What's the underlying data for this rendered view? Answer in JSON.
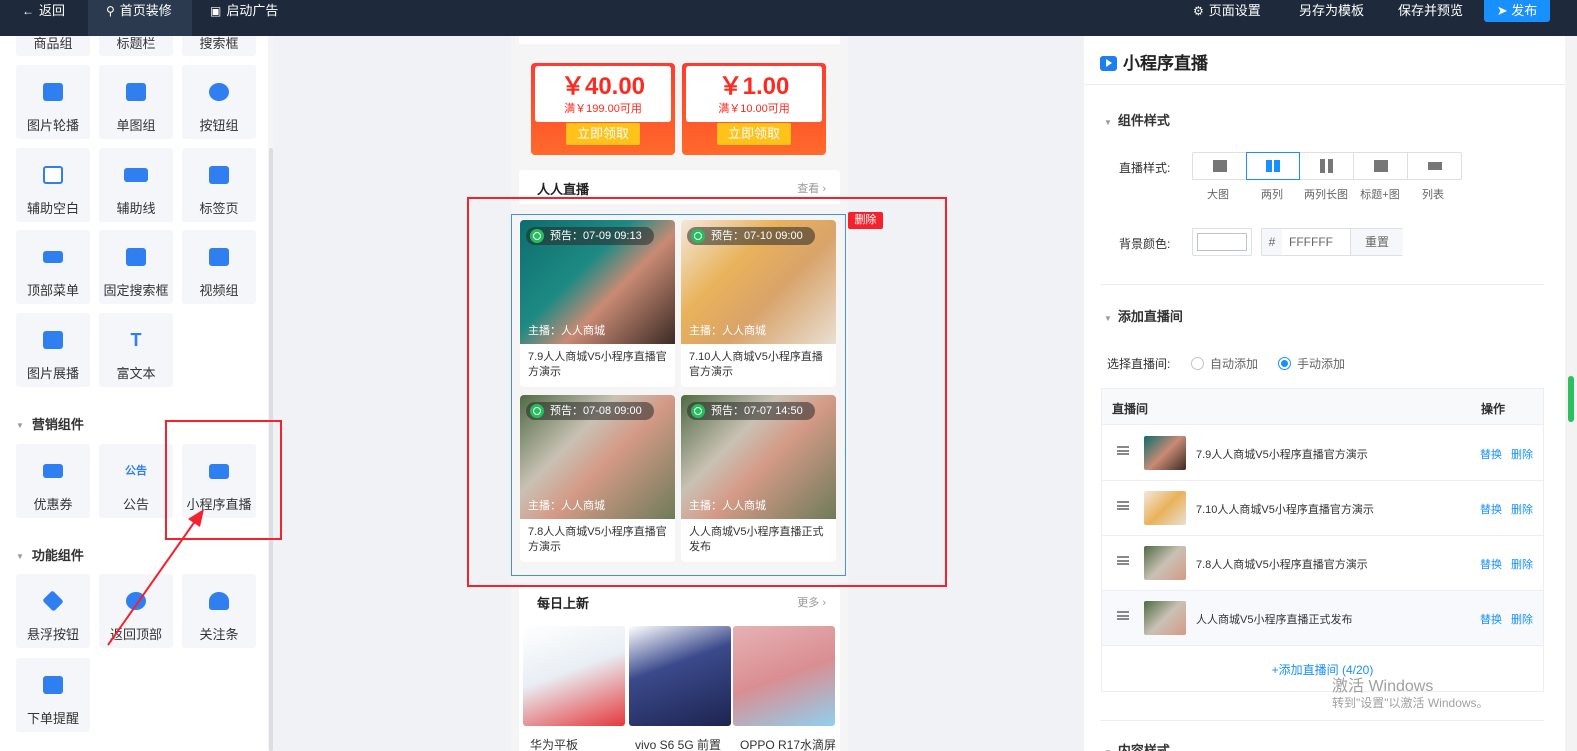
{
  "topbar": {
    "back": "返回",
    "decorate": "首页装修",
    "ad": "启动广告",
    "page_settings": "页面设置",
    "save_template": "另存为模板",
    "save_preview": "保存并预览",
    "publish": "发布"
  },
  "left": {
    "cut_row": [
      "商品组",
      "标题栏",
      "搜索框"
    ],
    "basic_tiles": [
      "图片轮播",
      "单图组",
      "按钮组",
      "辅助空白",
      "辅助线",
      "标签页",
      "顶部菜单",
      "固定搜索框",
      "视频组",
      "图片展播",
      "富文本"
    ],
    "marketing_title": "营销组件",
    "marketing_tiles": [
      "优惠券",
      "公告",
      "小程序直播"
    ],
    "function_title": "功能组件",
    "function_tiles": [
      "悬浮按钮",
      "返回顶部",
      "关注条",
      "下单提醒"
    ]
  },
  "preview": {
    "coupons": [
      {
        "amount": "￥40.00",
        "condition": "满￥199.00可用",
        "button": "立即领取"
      },
      {
        "amount": "￥1.00",
        "condition": "满￥10.00可用",
        "button": "立即领取"
      }
    ],
    "live_section": {
      "title": "人人直播",
      "more": "查看"
    },
    "delete_tag": "删除",
    "live_cards": [
      {
        "badge": "预告：07-09 09:13",
        "anchor": "主播：人人商城",
        "title": "7.9人人商城V5小程序直播官方演示"
      },
      {
        "badge": "预告：07-10 09:00",
        "anchor": "主播：人人商城",
        "title": "7.10人人商城V5小程序直播官方演示"
      },
      {
        "badge": "预告：07-08 09:00",
        "anchor": "主播：人人商城",
        "title": "7.8人人商城V5小程序直播官方演示"
      },
      {
        "badge": "预告：07-07 14:50",
        "anchor": "主播：人人商城",
        "title": "人人商城V5小程序直播正式发布"
      }
    ],
    "daily_section": {
      "title": "每日上新",
      "more": "更多"
    },
    "products": [
      "华为平板",
      "vivo S6 5G 前置",
      "OPPO R17水滴屏"
    ]
  },
  "right": {
    "title": "小程序直播",
    "group_style": "组件样式",
    "live_style_label": "直播样式:",
    "style_options": [
      "大图",
      "两列",
      "两列长图",
      "标题+图",
      "列表"
    ],
    "selected_style": "两列",
    "bg_color_label": "背景颜色:",
    "hex_prefix": "#",
    "bg_color_value": "FFFFFF",
    "reset": "重置",
    "group_add": "添加直播间",
    "select_label": "选择直播间:",
    "radio_auto": "自动添加",
    "radio_manual": "手动添加",
    "selected_mode": "手动添加",
    "table_head": {
      "name": "直播间",
      "ops": "操作"
    },
    "rows": [
      {
        "name": "7.9人人商城V5小程序直播官方演示",
        "replace": "替换",
        "delete": "删除"
      },
      {
        "name": "7.10人人商城V5小程序直播官方演示",
        "replace": "替换",
        "delete": "删除"
      },
      {
        "name": "7.8人人商城V5小程序直播官方演示",
        "replace": "替换",
        "delete": "删除"
      },
      {
        "name": "人人商城V5小程序直播正式发布",
        "replace": "替换",
        "delete": "删除"
      }
    ],
    "add_room": "+添加直播间 (4/20)",
    "bottom_cut": "内容样式"
  },
  "watermark": {
    "line1": "激活 Windows",
    "line2": "转到\"设置\"以激活 Windows。"
  },
  "colors": {
    "topbar": "#1e2a3b",
    "accent": "#1890ff",
    "annotation_red": "#f5222d",
    "coupon_red": "#ff3b2f",
    "live_badge_green": "#21c05a"
  }
}
